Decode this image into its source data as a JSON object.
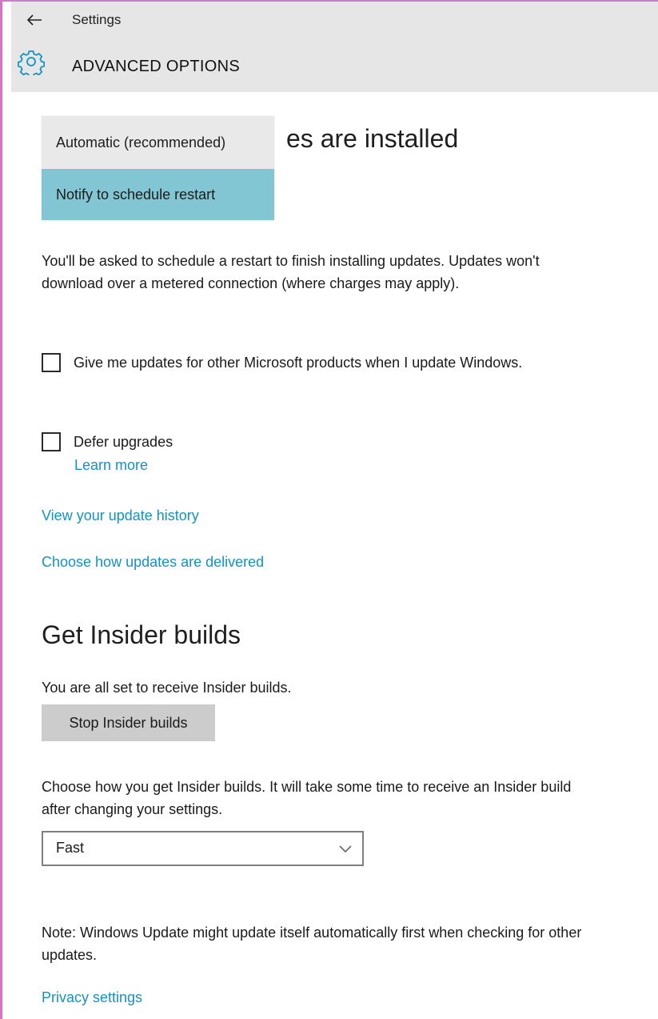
{
  "header": {
    "app_title": "Settings",
    "page_title": "ADVANCED OPTIONS",
    "back_icon": "back-arrow-icon",
    "settings_icon": "gear-icon"
  },
  "install_section": {
    "heading_visible_fragment": "es are installed",
    "dropdown_options": [
      "Automatic (recommended)",
      "Notify to schedule restart"
    ],
    "selected_option": "Notify to schedule restart",
    "description": "You'll be asked to schedule a restart to finish installing updates. Updates won't download over a metered connection (where charges may apply).",
    "checkbox_other_products": {
      "label": "Give me updates for other Microsoft products when I update Windows.",
      "checked": false
    },
    "checkbox_defer": {
      "label": "Defer upgrades",
      "checked": false
    },
    "learn_more_link": "Learn more",
    "view_history_link": "View your update history",
    "delivery_link": "Choose how updates are delivered"
  },
  "insider_section": {
    "heading": "Get Insider builds",
    "status": "You are all set to receive Insider builds.",
    "stop_button": "Stop Insider builds",
    "description": "Choose how you get Insider builds. It will take some time to receive an Insider build after changing your settings.",
    "ring_select_value": "Fast",
    "note": "Note: Windows Update might update itself automatically first when checking for other updates.",
    "privacy_link": "Privacy settings"
  },
  "colors": {
    "accent_link": "#1493c2",
    "selected_option_bg": "#83c6d3",
    "header_bg": "#e6e6e6",
    "window_edge": "#d874c8"
  }
}
